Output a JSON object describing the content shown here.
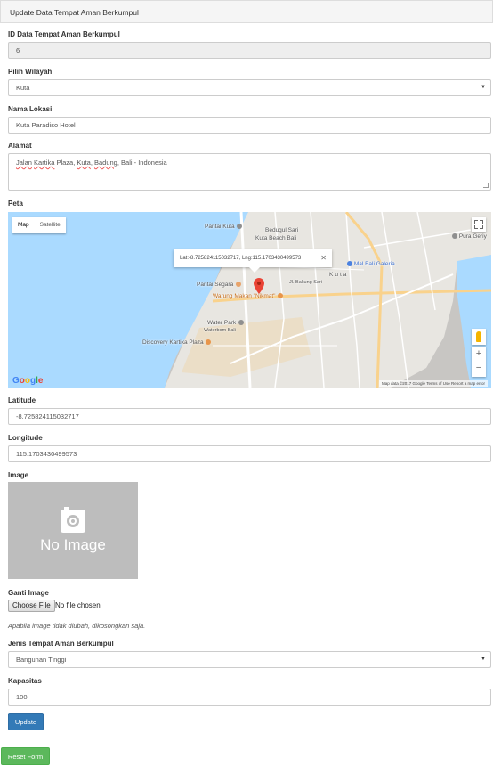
{
  "panel": {
    "title": "Update Data Tempat Aman Berkumpul"
  },
  "form": {
    "id_label": "ID Data Tempat Aman Berkumpul",
    "id_value": "6",
    "wilayah_label": "Pilih Wilayah",
    "wilayah_value": "Kuta",
    "lokasi_label": "Nama Lokasi",
    "lokasi_value": "Kuta Paradiso Hotel",
    "alamat_label": "Alamat",
    "alamat_parts": [
      "Jalan",
      " ",
      "Kartika",
      " Plaza, ",
      "Kuta",
      ", ",
      "Badung",
      ", Bali - Indonesia"
    ],
    "peta_label": "Peta",
    "lat_label": "Latitude",
    "lat_value": "-8.725824115032717",
    "lng_label": "Longitude",
    "lng_value": "115.1703430499573",
    "image_label": "Image",
    "no_image_text": "No Image",
    "ganti_label": "Ganti Image",
    "choose_file": "Choose File",
    "no_file": "No file chosen",
    "help_text": "Apabila image tidak diubah, dikosongkan saja.",
    "jenis_label": "Jenis Tempat Aman Berkumpul",
    "jenis_value": "Bangunan Tinggi",
    "kapasitas_label": "Kapasitas",
    "kapasitas_value": "100",
    "update_button": "Update",
    "reset_button": "Reset Form"
  },
  "map": {
    "type_map": "Map",
    "type_satellite": "Satellite",
    "infowindow": "Lat:-8.725824115032717, Lng:115.1703430499573",
    "places": {
      "pantai_kuta": "Pantai Kuta",
      "bedugul": "Bedugul Sari",
      "kuta_beach": "Kuta Beach Bali",
      "mal_bali": "Mal Bali Galeria",
      "pura": "Pura Geriy",
      "kuta": "Kuta",
      "jl_bakung": "Jl. Bakung Sari",
      "pantai_segara": "Pantai Segara",
      "warung": "Warung Makan \"Nikmat\"",
      "water_park": "Water Park",
      "waterbom": "Waterbom Bali",
      "discovery": "Discovery Kartika Plaza"
    },
    "google": "Google",
    "terms": "Map data ©2017 Google   Terms of Use   Report a map error",
    "zoom_in": "+",
    "zoom_out": "−"
  },
  "colors": {
    "primary": "#337ab7",
    "success": "#5cb85c",
    "sea": "#aadaff",
    "pin": "#ea4335"
  }
}
